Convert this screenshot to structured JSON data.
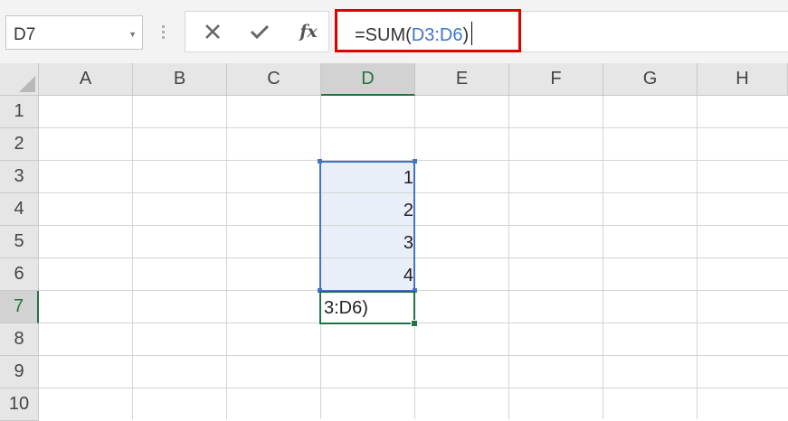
{
  "name_box": {
    "value": "D7"
  },
  "formula_bar": {
    "fx_label": "fx",
    "formula_prefix": "=SUM(",
    "formula_range": "D3:D6",
    "formula_suffix": ")"
  },
  "columns": [
    "A",
    "B",
    "C",
    "D",
    "E",
    "F",
    "G",
    "H"
  ],
  "rows": [
    "1",
    "2",
    "3",
    "4",
    "5",
    "6",
    "7",
    "8",
    "9",
    "10"
  ],
  "selected_column": "D",
  "selected_row": "7",
  "cells": {
    "D3": "1",
    "D4": "2",
    "D5": "3",
    "D6": "4"
  },
  "active_cell_display": "3:D6)",
  "colors": {
    "highlight_box": "#e00000",
    "range_border": "#4472c4",
    "range_fill": "#e9eff8",
    "active_green": "#217346",
    "reference_text": "#3f74c4"
  }
}
